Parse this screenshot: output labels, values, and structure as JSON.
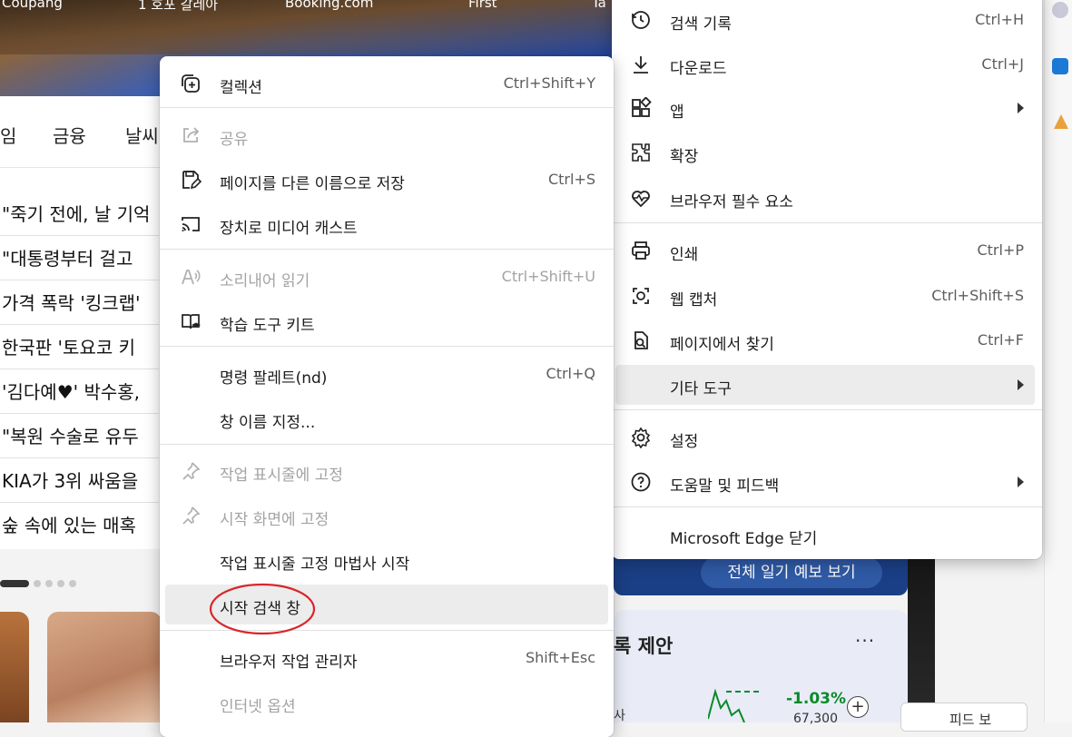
{
  "favorites": [
    "Coupang",
    "1 호포 갈레아",
    "Booking.com",
    "First",
    "Ta"
  ],
  "categories": [
    "임",
    "금융",
    "날씨"
  ],
  "news": [
    "\"죽기 전에, 날 기억",
    "\"대통령부터 걸고",
    "가격 폭락 '킹크랩'",
    "한국판 '토요코 키",
    "'김다예♥' 박수홍,",
    "\"복원 수술로 유두",
    "KIA가 3위 싸움을",
    "숲 속에 있는 매혹"
  ],
  "weather_button": "전체 일기 예보 보기",
  "stock": {
    "title": "록 제안",
    "more": "···",
    "change": "-1.03%",
    "price": "67,300",
    "cut_label": "사",
    "add": "+"
  },
  "feed_button": "피드 보",
  "main_menu": {
    "items": [
      {
        "label": "검색 기록",
        "shortcut": "Ctrl+H",
        "icon": "history-icon"
      },
      {
        "label": "다운로드",
        "shortcut": "Ctrl+J",
        "icon": "download-icon"
      },
      {
        "label": "앱",
        "shortcut": "",
        "icon": "apps-icon"
      },
      {
        "label": "확장",
        "shortcut": "",
        "icon": "extensions-icon"
      },
      {
        "label": "브라우저 필수 요소",
        "shortcut": "",
        "icon": "browser-essentials-icon"
      },
      {
        "label": "인쇄",
        "shortcut": "Ctrl+P",
        "icon": "print-icon"
      },
      {
        "label": "웹 캡처",
        "shortcut": "Ctrl+Shift+S",
        "icon": "web-capture-icon"
      },
      {
        "label": "페이지에서 찾기",
        "shortcut": "Ctrl+F",
        "icon": "find-icon"
      },
      {
        "label": "기타 도구",
        "shortcut": "",
        "icon": ""
      },
      {
        "label": "설정",
        "shortcut": "",
        "icon": "settings-icon"
      },
      {
        "label": "도움말 및 피드백",
        "shortcut": "",
        "icon": "help-icon"
      },
      {
        "label": "Microsoft Edge 닫기",
        "shortcut": "",
        "icon": ""
      }
    ]
  },
  "sub_menu": {
    "items": [
      {
        "label": "컬렉션",
        "shortcut": "Ctrl+Shift+Y",
        "icon": "collections-icon"
      },
      {
        "label": "공유",
        "shortcut": "",
        "icon": "share-icon"
      },
      {
        "label": "페이지를 다른 이름으로 저장",
        "shortcut": "Ctrl+S",
        "icon": "save-as-icon"
      },
      {
        "label": "장치로 미디어 캐스트",
        "shortcut": "",
        "icon": "cast-icon"
      },
      {
        "label": "소리내어 읽기",
        "shortcut": "Ctrl+Shift+U",
        "icon": "read-aloud-icon"
      },
      {
        "label": "학습 도구 키트",
        "shortcut": "",
        "icon": "learning-toolkit-icon"
      },
      {
        "label": "명령 팔레트(nd)",
        "shortcut": "Ctrl+Q",
        "icon": ""
      },
      {
        "label": "창 이름 지정...",
        "shortcut": "",
        "icon": ""
      },
      {
        "label": "작업 표시줄에 고정",
        "shortcut": "",
        "icon": "pin-icon"
      },
      {
        "label": "시작 화면에 고정",
        "shortcut": "",
        "icon": "pin-icon"
      },
      {
        "label": "작업 표시줄 고정 마법사 시작",
        "shortcut": "",
        "icon": ""
      },
      {
        "label": "시작 검색 창",
        "shortcut": "",
        "icon": ""
      },
      {
        "label": "브라우저 작업 관리자",
        "shortcut": "Shift+Esc",
        "icon": ""
      },
      {
        "label": "인터넷 옵션",
        "shortcut": "",
        "icon": ""
      }
    ]
  },
  "highlight_color": "#d8262b"
}
